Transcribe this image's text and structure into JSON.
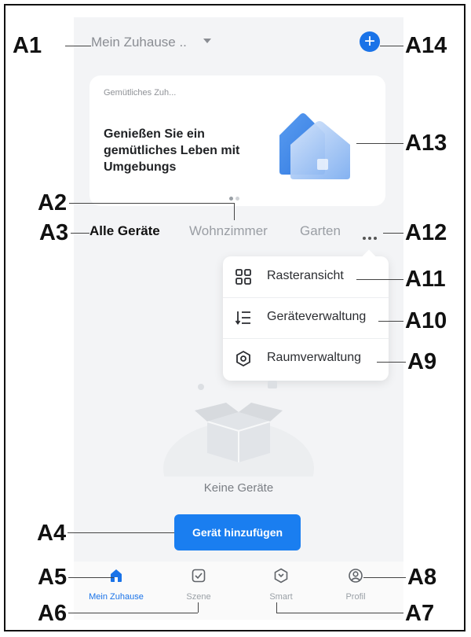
{
  "callouts": {
    "a1": "A1",
    "a2": "A2",
    "a3": "A3",
    "a4": "A4",
    "a5": "A5",
    "a6": "A6",
    "a7": "A7",
    "a8": "A8",
    "a9": "A9",
    "a10": "A10",
    "a11": "A11",
    "a12": "A12",
    "a13": "A13",
    "a14": "A14"
  },
  "header": {
    "home_selector": "Mein Zuhause ..",
    "add_icon": "plus-icon"
  },
  "banner": {
    "small_title": "Gemütliches Zuh...",
    "headline": "Genießen Sie ein gemütliches Leben mit Umgebungs",
    "illustration": "house-illustration",
    "pages": 2,
    "active_page": 1
  },
  "tabs": [
    {
      "label": "Alle Geräte",
      "active": true
    },
    {
      "label": "Wohnzimmer",
      "active": false
    },
    {
      "label": "Garten",
      "active": false
    }
  ],
  "more_icon": "more-dots-icon",
  "menu": {
    "items": [
      {
        "label": "Rasteransicht",
        "icon": "grid-icon"
      },
      {
        "label": "Geräteverwaltung",
        "icon": "sort-list-icon"
      },
      {
        "label": "Raumverwaltung",
        "icon": "hexagon-settings-icon"
      }
    ]
  },
  "empty_state": {
    "illustration": "empty-box-illustration",
    "text": "Keine Geräte"
  },
  "cta": {
    "label": "Gerät hinzufügen"
  },
  "bottom_nav": [
    {
      "label": "Mein Zuhause",
      "icon": "home-icon",
      "active": true
    },
    {
      "label": "Szene",
      "icon": "scene-checkbox-icon",
      "active": false
    },
    {
      "label": "Smart",
      "icon": "smart-hexagon-icon",
      "active": false
    },
    {
      "label": "Profil",
      "icon": "profile-icon",
      "active": false
    }
  ],
  "colors": {
    "accent": "#1a73e8",
    "cta": "#1a7ef0",
    "background": "#f3f4f6"
  }
}
